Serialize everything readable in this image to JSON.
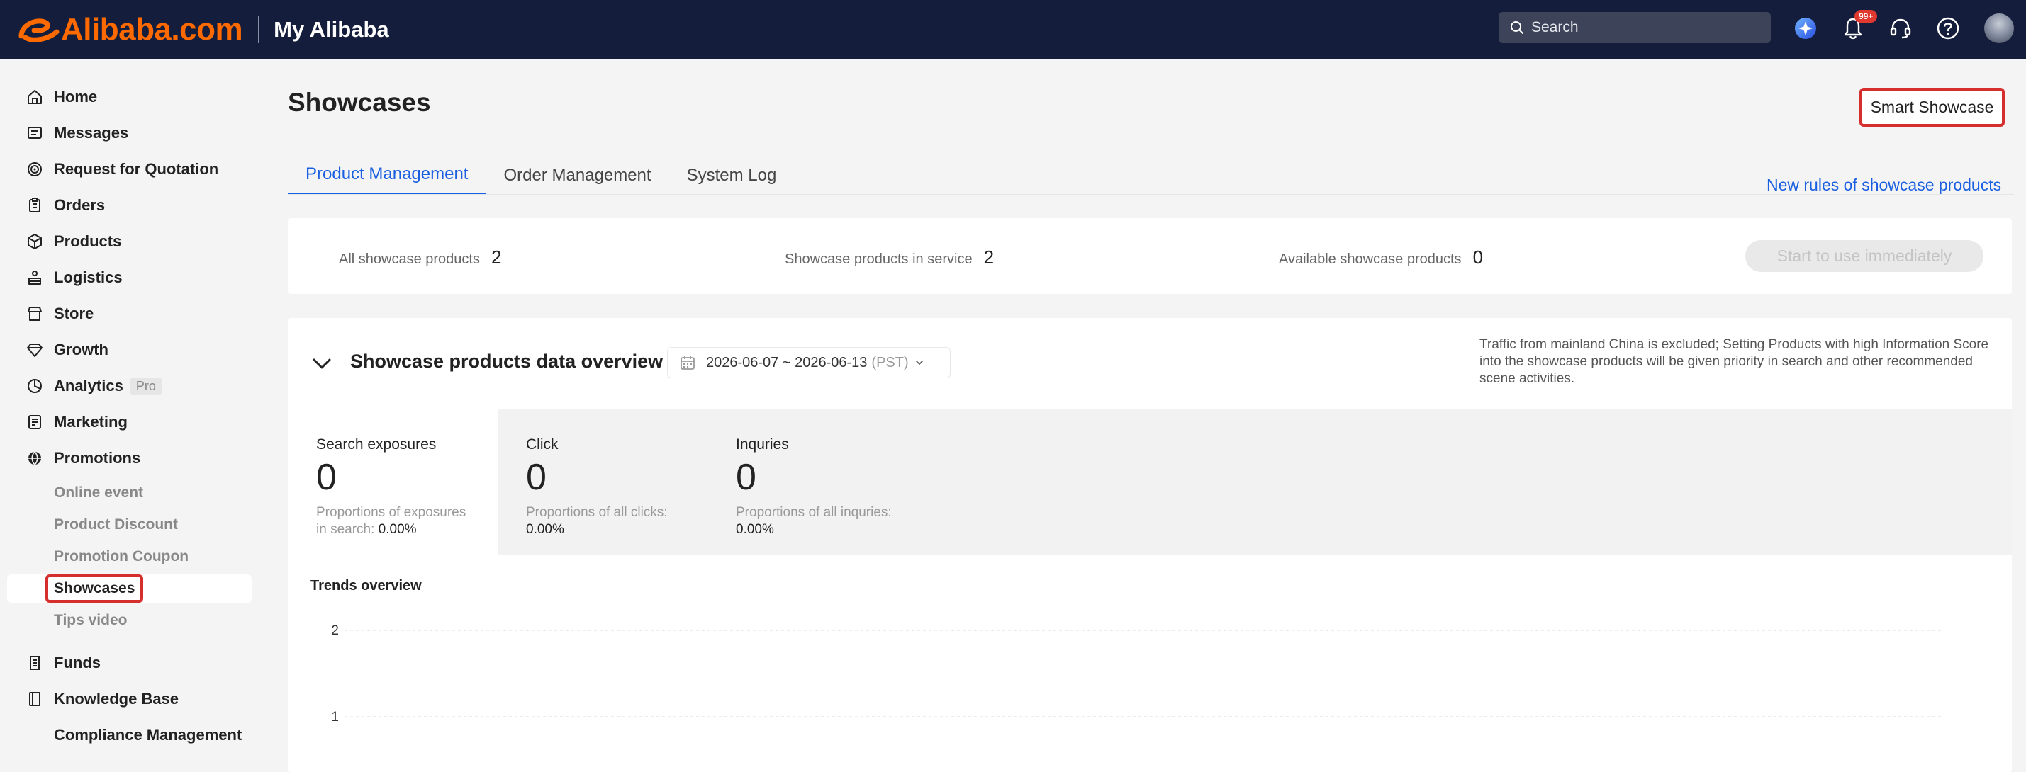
{
  "brand": {
    "logo_text": "Alibaba.com",
    "section": "My Alibaba"
  },
  "topbar": {
    "search_placeholder": "Search",
    "notification_badge": "99+",
    "icons": [
      "ai-assistant-icon",
      "bell-icon",
      "headset-icon",
      "help-icon",
      "avatar"
    ]
  },
  "sidebar": {
    "items": [
      {
        "label": "Home",
        "icon": "home-icon"
      },
      {
        "label": "Messages",
        "icon": "messages-icon"
      },
      {
        "label": "Request for Quotation",
        "icon": "target-icon"
      },
      {
        "label": "Orders",
        "icon": "clipboard-icon"
      },
      {
        "label": "Products",
        "icon": "box-icon"
      },
      {
        "label": "Logistics",
        "icon": "truck-icon"
      },
      {
        "label": "Store",
        "icon": "store-icon"
      },
      {
        "label": "Growth",
        "icon": "diamond-icon"
      },
      {
        "label": "Analytics",
        "icon": "pie-chart-icon",
        "tag": "Pro"
      },
      {
        "label": "Marketing",
        "icon": "marketing-icon"
      },
      {
        "label": "Promotions",
        "icon": "globe-icon"
      },
      {
        "label": "Funds",
        "icon": "funds-icon"
      },
      {
        "label": "Knowledge Base",
        "icon": "book-icon"
      },
      {
        "label": "Compliance Management",
        "icon": ""
      }
    ],
    "promotions_sub": [
      "Online event",
      "Product Discount",
      "Promotion Coupon",
      "Showcases",
      "Tips video"
    ],
    "active_sub": "Showcases"
  },
  "page": {
    "title": "Showcases",
    "smart_button": "Smart Showcase",
    "tabs": [
      "Product Management",
      "Order Management",
      "System Log"
    ],
    "active_tab": "Product Management",
    "rules_link": "New rules of showcase products"
  },
  "stats": {
    "all_label": "All showcase products",
    "all_value": "2",
    "in_service_label": "Showcase products in service",
    "in_service_value": "2",
    "available_label": "Available showcase products",
    "available_value": "0",
    "start_button": "Start to use immediately"
  },
  "overview": {
    "title": "Showcase products data overview",
    "date_range": "2026-06-07 ~ 2026-06-13",
    "timezone": "(PST)",
    "note": "Traffic from mainland China is excluded; Setting Products with high Information Score into the showcase products will be given priority in search and other recommended scene activities.",
    "metrics": [
      {
        "name": "Search exposures",
        "value": "0",
        "sub": "Proportions of exposures in search:",
        "pct": "0.00%"
      },
      {
        "name": "Click",
        "value": "0",
        "sub": "Proportions of all clicks:",
        "pct": "0.00%"
      },
      {
        "name": "Inquries",
        "value": "0",
        "sub": "Proportions of all inquries:",
        "pct": "0.00%"
      }
    ],
    "trends_title": "Trends overview"
  },
  "chart_data": {
    "type": "line",
    "title": "Trends overview",
    "y_ticks": [
      "2",
      "1"
    ],
    "ylim": [
      0,
      2
    ],
    "grid": true,
    "series": []
  },
  "colors": {
    "topbar": "#141d3b",
    "brand": "#ff6a00",
    "accent": "#1a5fe0",
    "highlight": "#d62d2d"
  }
}
